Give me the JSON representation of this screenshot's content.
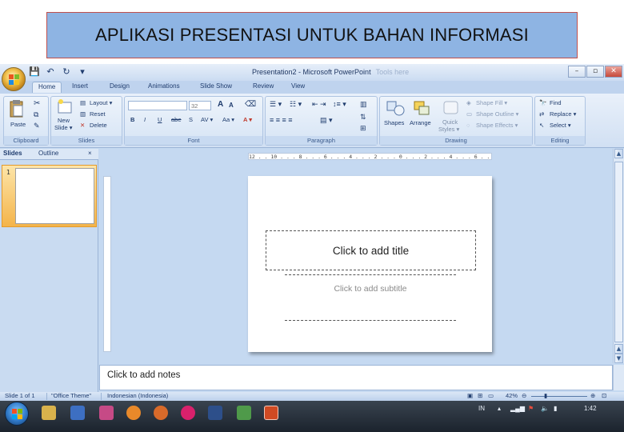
{
  "banner": {
    "title": "APLIKASI PRESENTASI UNTUK BAHAN INFORMASI"
  },
  "window": {
    "title": "Presentation2 - Microsoft PowerPoint",
    "title_faint": "Tools here",
    "controls": {
      "minimize": "–",
      "maximize": "▫",
      "close": "✕"
    }
  },
  "tabs": [
    "Home",
    "Insert",
    "Design",
    "Animations",
    "Slide Show",
    "Review",
    "View"
  ],
  "ribbon": {
    "clipboard": {
      "label": "Clipboard",
      "paste": "Paste"
    },
    "slides": {
      "label": "Slides",
      "new_slide_1": "New",
      "new_slide_2": "Slide ▾",
      "layout": "Layout ▾",
      "reset": "Reset",
      "delete": "Delete"
    },
    "font": {
      "label": "Font",
      "size": "32",
      "grow": "A",
      "shrink": "A",
      "bold": "B",
      "italic": "I",
      "underline": "U",
      "strike": "abe",
      "shadow": "S",
      "spacing": "AV ▾",
      "case": "Aa ▾",
      "color": "A ▾"
    },
    "paragraph": {
      "label": "Paragraph"
    },
    "drawing": {
      "label": "Drawing",
      "shapes": "Shapes",
      "arrange": "Arrange",
      "quick_styles_1": "Quick",
      "quick_styles_2": "Styles ▾",
      "shape_fill": "Shape Fill ▾",
      "shape_outline": "Shape Outline ▾",
      "shape_effects": "Shape Effects ▾"
    },
    "editing": {
      "label": "Editing",
      "find": "Find",
      "replace": "Replace ▾",
      "select": "Select ▾"
    }
  },
  "panel": {
    "tab_slides": "Slides",
    "tab_outline": "Outline",
    "close": "×",
    "slide_number": "1"
  },
  "ruler": {
    "text": "12 . . 10 . . . 8 . . . 6 . . . 4 . . . 2 . . . 0 . . . 2 . . . 4 . . . 6 . . . 8 . . . 10 . . 12"
  },
  "slide": {
    "title_placeholder": "Click to add title",
    "subtitle_placeholder": "Click to add subtitle"
  },
  "notes": {
    "placeholder": "Click to add notes"
  },
  "status": {
    "slide": "Slide 1 of 1",
    "theme": "\"Office Theme\"",
    "language": "Indonesian (Indonesia)",
    "zoom": "42%"
  },
  "taskbar": {
    "lang": "IN",
    "time": "1:42"
  },
  "colors": {
    "banner_fill": "#8eb4e3",
    "banner_border": "#c0504d",
    "ribbon": "#d1e0f3",
    "app_bg": "#c5d9f1"
  }
}
